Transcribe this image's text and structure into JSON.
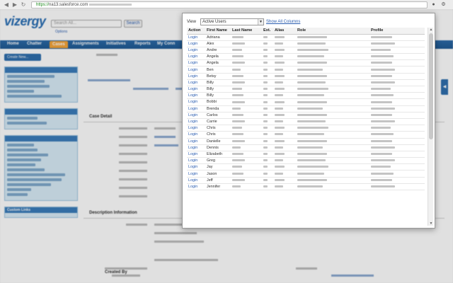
{
  "browser": {
    "url_scheme": "https://",
    "url_host": "na13.salesforce.com",
    "icons": [
      "back-icon",
      "forward-icon",
      "reload-icon",
      "extension-icon",
      "wrench-icon"
    ]
  },
  "sf": {
    "logo": "vizergy",
    "logo_tagline": "",
    "search_placeholder": "Search All...",
    "search_button": "Search",
    "options_link": "Options",
    "tabs": [
      "Home",
      "Chatter",
      "Cases",
      "Assignments",
      "Initiatives",
      "Reports",
      "My Conn"
    ],
    "create_button": "Create New...",
    "section_case_detail": "Case Detail",
    "section_description": "Description Information",
    "custom_links": "Custom Links",
    "field_created_by": "Created By"
  },
  "popup": {
    "view_label": "View",
    "view_selected": "Active Users",
    "show_all_columns": "Show All Columns",
    "columns": [
      "Action",
      "First Name",
      "Last Name",
      "Ext.",
      "Alias",
      "Role",
      "Profile"
    ],
    "action_label": "Login",
    "visible_first_names": [
      "Adriana",
      "Alex",
      "Andre",
      "Angela",
      "Angela",
      "Ben",
      "Betsy",
      "Billy",
      "Billy",
      "Billy",
      "Bobbi",
      "Brenda",
      "Carlos",
      "Carrie",
      "Chris",
      "Chris",
      "Danielle",
      "Dennis",
      "Elizabeth",
      "Greg",
      "Jay",
      "Jason",
      "Jeff",
      "Jennifer"
    ],
    "row_count": 24
  }
}
